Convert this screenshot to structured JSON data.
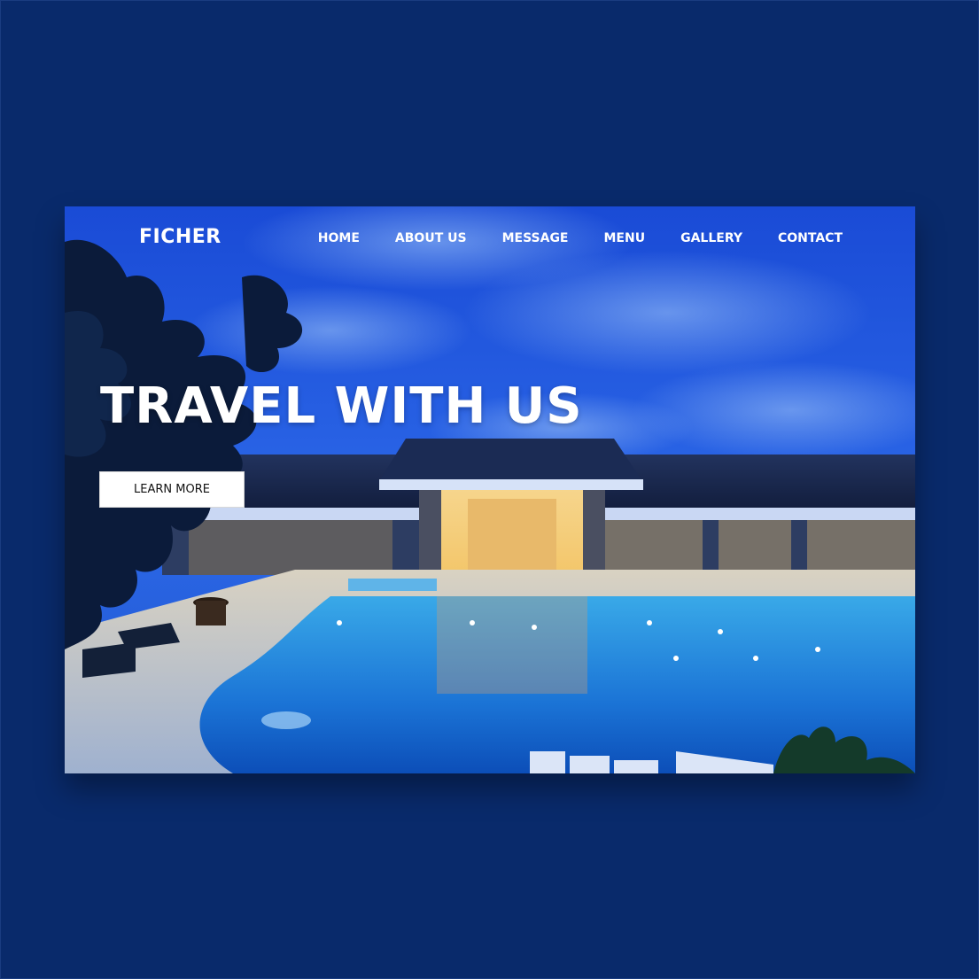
{
  "brand": {
    "logo_text": "FICHER"
  },
  "nav": {
    "items": [
      {
        "label": "HOME"
      },
      {
        "label": "ABOUT US"
      },
      {
        "label": "MESSAGE"
      },
      {
        "label": "MENU"
      },
      {
        "label": "GALLERY"
      },
      {
        "label": "CONTACT"
      }
    ]
  },
  "hero": {
    "title": "TRAVEL WITH US",
    "cta_label": "LEARN MORE",
    "image": "night-resort-pool-photo"
  },
  "colors": {
    "page_background": "#092a6b",
    "hero_sky": "#1d4fd8",
    "text_light": "#ffffff",
    "button_background": "#ffffff",
    "button_text": "#111111"
  }
}
